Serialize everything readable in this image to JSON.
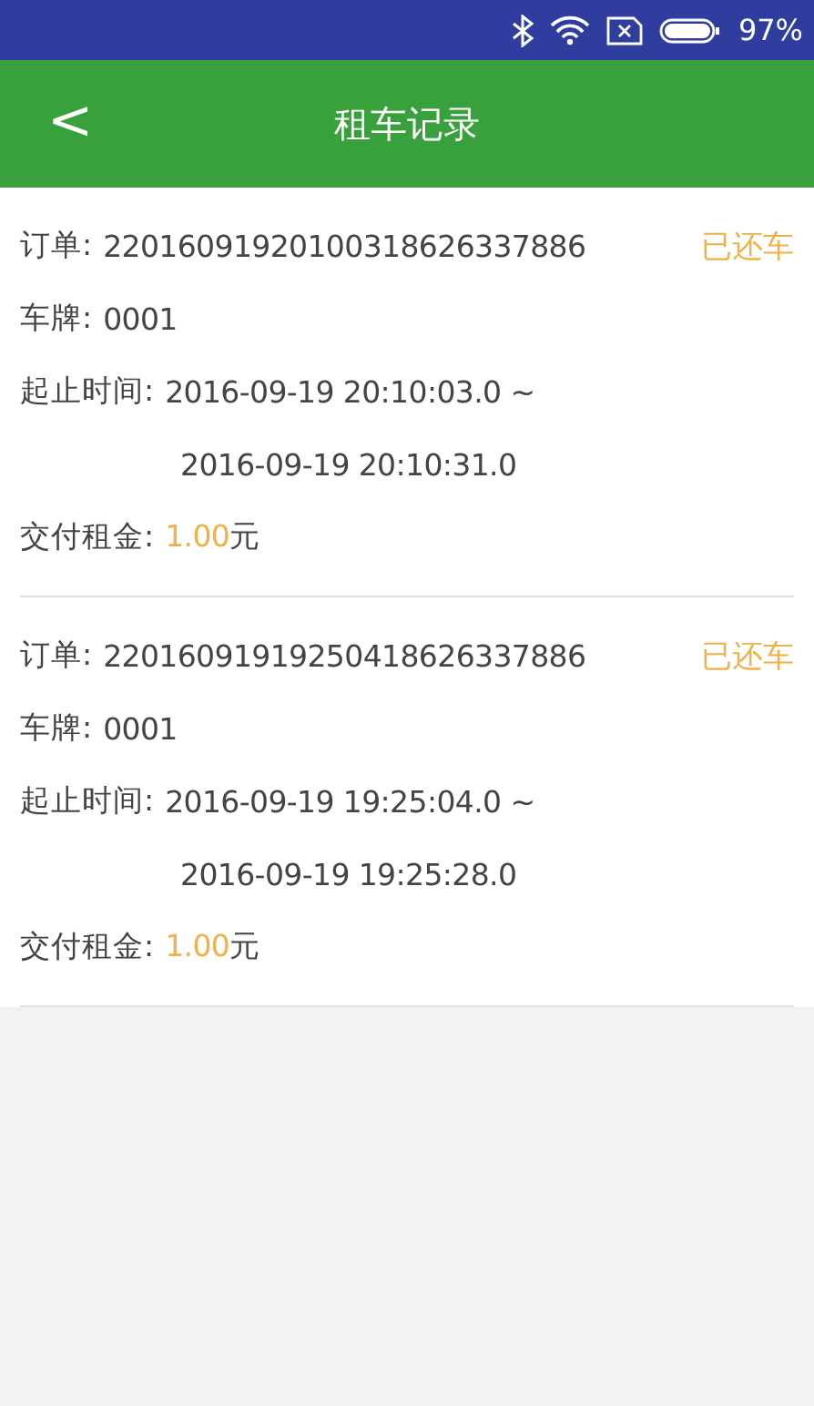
{
  "status_bar": {
    "battery": "97%"
  },
  "header": {
    "back": "<",
    "title": "租车记录"
  },
  "records": [
    {
      "order_label": "订单:",
      "order": "22016091920100318626337886",
      "status": "已还车",
      "plate_label": "车牌:",
      "plate": "0001",
      "time_label": "起止时间:",
      "start": "2016-09-19 20:10:03.0 ~",
      "end": "2016-09-19 20:10:31.0",
      "fee_label": "交付租金:",
      "amount": "1.00",
      "unit": "元"
    },
    {
      "order_label": "订单:",
      "order": "22016091919250418626337886",
      "status": "已还车",
      "plate_label": "车牌:",
      "plate": "0001",
      "time_label": "起止时间:",
      "start": "2016-09-19 19:25:04.0 ~",
      "end": "2016-09-19 19:25:28.0",
      "fee_label": "交付租金:",
      "amount": "1.00",
      "unit": "元"
    }
  ]
}
